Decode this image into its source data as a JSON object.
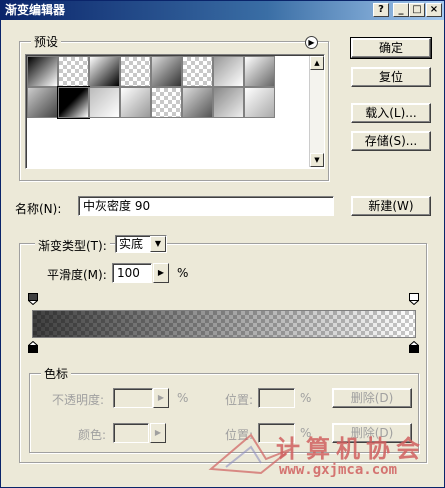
{
  "window": {
    "title": "渐变编辑器"
  },
  "titlebar_buttons": {
    "help": "?",
    "minimize": "_",
    "maximize": "□",
    "close": "×"
  },
  "buttons": {
    "ok": "确定",
    "reset": "复位",
    "load": "载入(L)...",
    "save": "存储(S)...",
    "new": "新建(W)"
  },
  "presets": {
    "title": "预设",
    "menu_icon": "arrow-right-circle-icon"
  },
  "name": {
    "label": "名称(N):",
    "value": "中灰密度 90"
  },
  "gradient_type": {
    "label": "渐变类型(T):",
    "value": "实底"
  },
  "smoothness": {
    "label": "平滑度(M):",
    "value": "100",
    "unit": "%"
  },
  "color_stops": {
    "title": "色标",
    "opacity_label": "不透明度:",
    "opacity_unit": "%",
    "location_label": "位置:",
    "location_unit": "%",
    "delete_label": "删除(D)",
    "color_label": "颜色:",
    "location2_label": "位置:",
    "location2_unit": "%",
    "delete2_label": "删除(D)"
  },
  "watermark": {
    "text_cn": "计算机协会",
    "text_url": "www.gxjmca.com"
  },
  "colors": {
    "title_start": "#0a246a",
    "title_end": "#a6caf0",
    "face": "#ece9d8",
    "watermark": "#d06060"
  }
}
